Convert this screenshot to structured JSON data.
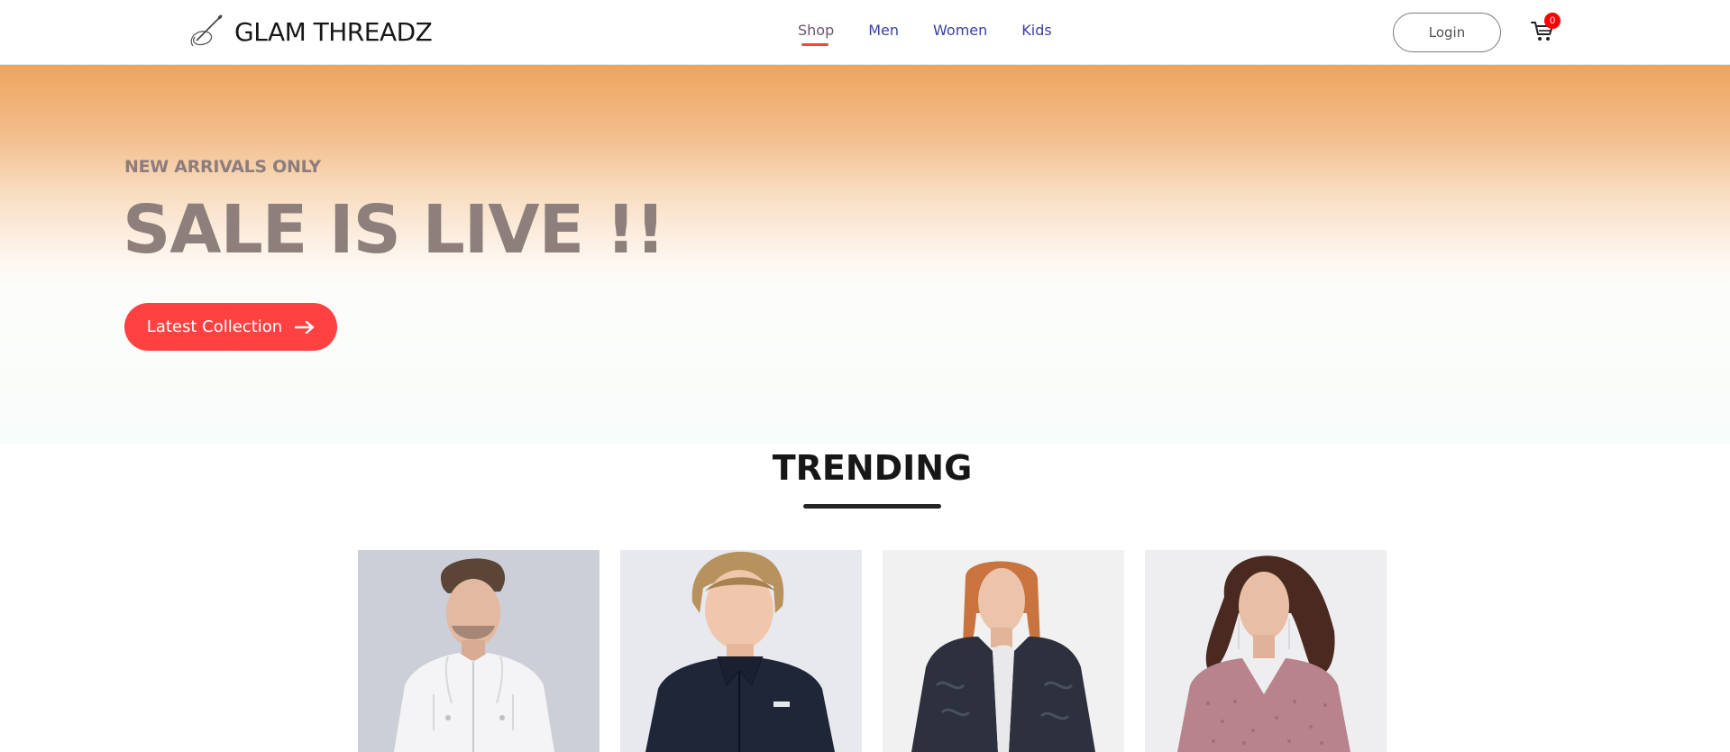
{
  "brand": {
    "name": "GLAM THREADZ",
    "logo_icon": "needle-thread-icon"
  },
  "nav": {
    "items": [
      {
        "label": "Shop",
        "active": true
      },
      {
        "label": "Men",
        "active": false
      },
      {
        "label": "Women",
        "active": false
      },
      {
        "label": "Kids",
        "active": false
      }
    ],
    "login_label": "Login",
    "cart_icon": "cart-icon",
    "cart_count": "0"
  },
  "hero": {
    "kicker": "NEW ARRIVALS ONLY",
    "title": "SALE IS LIVE !!",
    "button_label": "Latest Collection",
    "button_icon": "arrow-right-icon"
  },
  "trending": {
    "title": "TRENDING",
    "products": [
      {
        "image": "man-white-hooded-jacket"
      },
      {
        "image": "boy-navy-jacket"
      },
      {
        "image": "woman-fur-coat"
      },
      {
        "image": "woman-pink-dress"
      }
    ]
  },
  "colors": {
    "accent": "#ff4141",
    "nav_link": "#3a3fa6",
    "hero_top": "#eda45e",
    "hero_text": "#8c7f7c",
    "badge": "#ff0000"
  }
}
